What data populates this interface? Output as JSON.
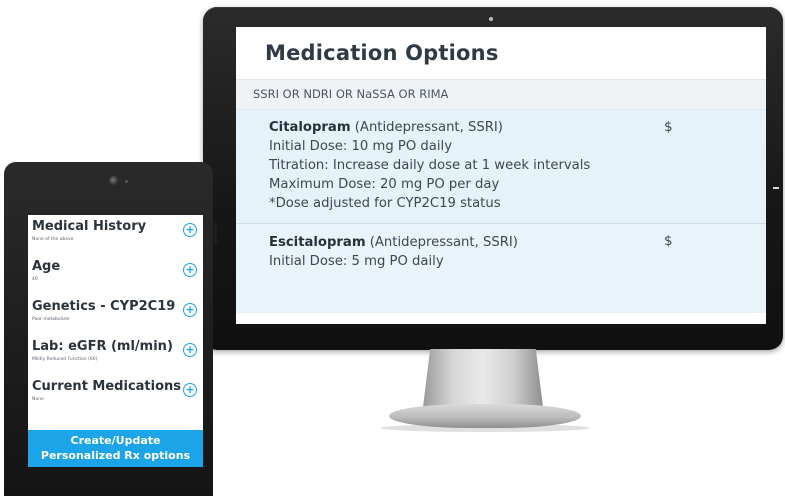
{
  "monitor": {
    "title": "Medication Options",
    "filter": "SSRI OR NDRI OR NaSSA OR RIMA",
    "medications": [
      {
        "name": "Citalopram",
        "class": "(Antidepressant, SSRI)",
        "price": "$",
        "details": [
          "Initial Dose: 10 mg PO daily",
          "Titration: Increase daily dose at 1 week intervals",
          "Maximum Dose: 20 mg PO per day",
          "*Dose adjusted for CYP2C19 status"
        ]
      },
      {
        "name": "Escitalopram",
        "class": "(Antidepressant, SSRI)",
        "price": "$",
        "details": [
          "Initial Dose: 5 mg PO daily"
        ]
      }
    ]
  },
  "tablet": {
    "items": [
      {
        "label": "Medical History",
        "value": "None of the above",
        "icon": "plus-circle-icon"
      },
      {
        "label": "Age",
        "value": "40",
        "icon": "plus-circle-icon"
      },
      {
        "label": "Genetics - CYP2C19",
        "value": "Poor metabolizer",
        "icon": "plus-circle-icon"
      },
      {
        "label": "Lab: eGFR (ml/min)",
        "value": "Mildly Reduced Function (60)",
        "icon": "plus-circle-icon"
      },
      {
        "label": "Current Medications",
        "value": "None",
        "icon": "plus-circle-icon"
      }
    ],
    "button_line1": "Create/Update",
    "button_line2": "Personalized Rx options"
  },
  "colors": {
    "accent": "#1ba5e8",
    "card_bg": "#e6f2fa",
    "filter_bg": "#f0f3f6",
    "title": "#2f3a46"
  }
}
